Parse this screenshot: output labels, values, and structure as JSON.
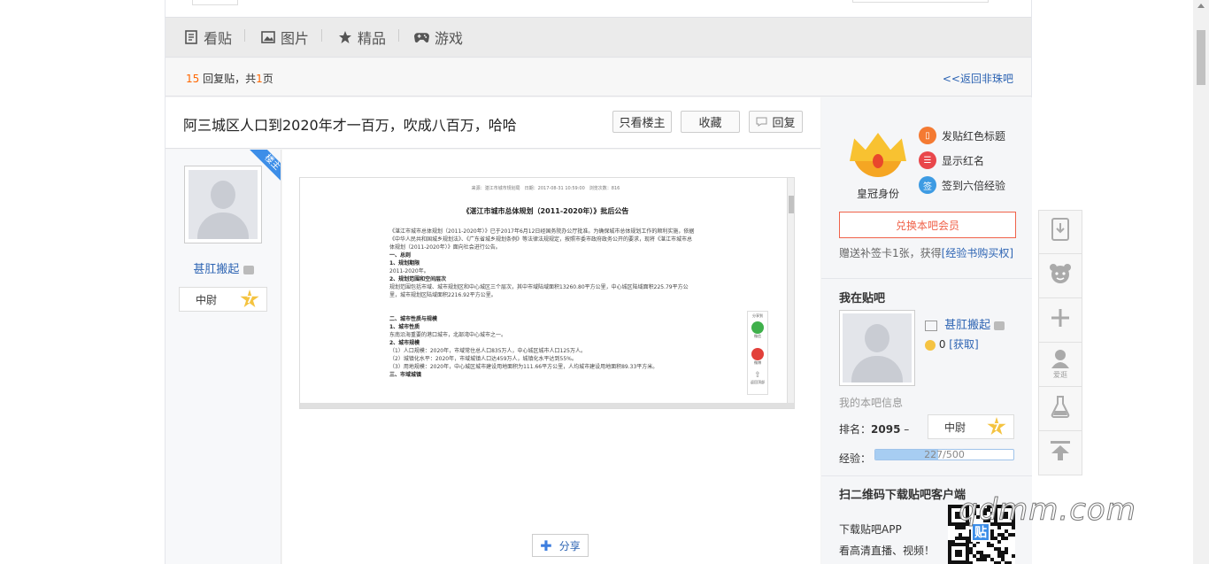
{
  "tabs": [
    {
      "label": "看贴",
      "icon": "document-icon"
    },
    {
      "label": "图片",
      "icon": "image-icon"
    },
    {
      "label": "精品",
      "icon": "star-icon"
    },
    {
      "label": "游戏",
      "icon": "gamepad-icon"
    }
  ],
  "pager": {
    "reply_count": "15",
    "reply_text": " 回复贴，共",
    "page_count": "1",
    "page_suffix": "页",
    "back_link": "<<返回非珠吧"
  },
  "thread": {
    "title": "阿三城区人口到2020年才一百万，吹成八百万，哈哈",
    "btn_only_op": "只看楼主",
    "btn_favorite": "收藏",
    "btn_reply": "回复"
  },
  "author": {
    "badge": "楼主",
    "name": "甚肛搬起",
    "rank_title": "中尉",
    "rank_level": "7"
  },
  "post_image": {
    "meta": "来源：湛江市城市规划局　日期：2017-08-31 10:59:00　浏览次数：816",
    "title": "《湛江市城市总体规划（2011-2020年）》批后公告",
    "intro": "《湛江市城市总体规划（2011-2020年）》已于2017年6月12日经国务院办公厅批准。为确保城市总体规划工作的顺利实施，依据《中华人民共和国城乡规划法》、《广东省城乡规划条例》等法律法规规定，按照市委市政府政务公开的要求，现将《湛江市城市总体规划（2011-2020年）》面向社会进行公告。",
    "h1": "一、总则",
    "h1_1": "1、规划期限",
    "p1_1": "2011-2020年。",
    "h1_2": "2、规划范围和空间层次",
    "p1_2": "规划范围包括市域、城市规划区和中心城区三个层次，其中市域陆域面积13260.80平方公里，中心城区陆域面积225.79平方公里，城市规划区陆域面积2216.92平方公里。",
    "h2": "二、城市性质与规模",
    "h2_1": "1、城市性质",
    "p2_1": "东南沿海重要的港口城市，北部湾中心城市之一。",
    "h2_2": "2、城市规模",
    "p2_2a": "（1）人口规模：2020年，市域常住总人口835万人，中心城区城市人口125万人。",
    "p2_2b": "（2）城镇化水平：2020年，市域城镇人口达459万人，城镇化水平达到55%。",
    "p2_2c": "（3）用地规模：2020年，中心城区城市建设用地面积为111.66平方公里，人均城市建设用地面积89.33平方米。",
    "h3": "三、市域城镇",
    "share_wechat": "微信",
    "share_weibo": "微博",
    "share_back": "返回顶部",
    "share_title": "分享到"
  },
  "share_button": "分享",
  "sidebar": {
    "crown_label": "皇冠身份",
    "perk1": "发贴红色标题",
    "perk2": "显示红名",
    "perk3": "签到六倍经验",
    "perk3_icon_text": "签",
    "redeem_button": "兑换本吧会员",
    "bonus_text": "赠送补签卡1张，获得",
    "bonus_link": "[经验书购买权]",
    "my_section_title": "我在贴吧",
    "my_name": "甚肛搬起",
    "my_coins": "0",
    "my_coins_link": "[获取]",
    "my_info_label": "我的本吧信息",
    "rank_label": "排名：",
    "rank_value": "2095",
    "rank_trend": "–",
    "rank_title": "中尉",
    "rank_level": "7",
    "exp_label": "经验：",
    "exp_text": "227/500",
    "exp_current": 227,
    "exp_max": 500,
    "qr_title": "扫二维码下载贴吧客户端",
    "qr_line1": "下载贴吧APP",
    "qr_line2": "看高清直播、视频！",
    "qr_center": "贴"
  },
  "right_tools": [
    {
      "icon": "download-app-icon",
      "label": ""
    },
    {
      "icon": "bear-face-icon",
      "label": ""
    },
    {
      "icon": "plus-icon",
      "label": ""
    },
    {
      "icon": "user-icon",
      "label": "爱逛"
    },
    {
      "icon": "flask-icon",
      "label": ""
    },
    {
      "icon": "back-to-top-icon",
      "label": ""
    }
  ],
  "watermark": "qdmm.com",
  "colors": {
    "link_blue": "#2d64b3",
    "accent_orange": "#f60",
    "redeem_red": "#f0624a",
    "badge_blue": "#3d8ee8"
  }
}
